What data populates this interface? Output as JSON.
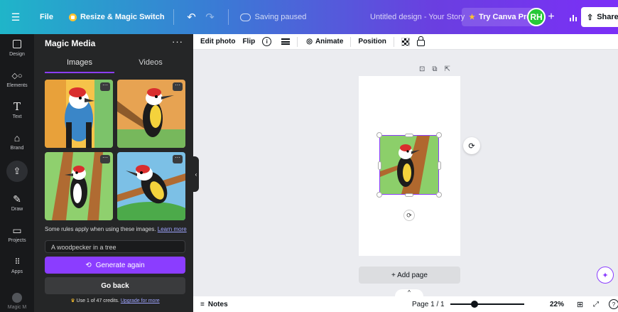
{
  "topbar": {
    "file_label": "File",
    "resize_label": "Resize & Magic Switch",
    "saving_status": "Saving paused",
    "document_title": "Untitled design - Your Story",
    "try_pro_label": "Try Canva Pro",
    "avatar_initials": "RH",
    "plus_label": "+",
    "share_label": "Share"
  },
  "rail": {
    "items": [
      {
        "label": "Design",
        "icon": "layout-icon"
      },
      {
        "label": "Elements",
        "icon": "shapes-icon"
      },
      {
        "label": "Text",
        "icon": "text-icon"
      },
      {
        "label": "Brand",
        "icon": "brand-icon"
      },
      {
        "label": "",
        "icon": "upload-icon"
      },
      {
        "label": "Draw",
        "icon": "draw-icon"
      },
      {
        "label": "Projects",
        "icon": "folder-icon"
      },
      {
        "label": "Apps",
        "icon": "apps-icon"
      },
      {
        "label": "Magic M",
        "icon": "avatar-icon"
      }
    ]
  },
  "panel": {
    "title": "Magic Media",
    "more_label": "···",
    "tabs": [
      "Images",
      "Videos"
    ],
    "active_tab": "Images",
    "rules_text": "Some rules apply when using these images.",
    "rules_link": "Learn more",
    "prompt_value": "A woodpecker in a tree",
    "generate_label": "Generate again",
    "back_label": "Go back",
    "credits_text": "Use 1 of 47 credits.",
    "credits_link": "Upgrade for more",
    "collapse_icon": "‹"
  },
  "context_toolbar": {
    "edit_photo": "Edit photo",
    "flip": "Flip",
    "animate": "Animate",
    "position": "Position"
  },
  "canvas": {
    "add_page_label": "+ Add page"
  },
  "footer": {
    "notes_label": "Notes",
    "page_indicator": "Page 1 / 1",
    "zoom_label": "22%",
    "zoom_value": 22
  },
  "colors": {
    "accent": "#8b3dff",
    "avatar_bg": "#28c837",
    "panel_bg": "#252627",
    "rail_bg": "#18191b"
  }
}
